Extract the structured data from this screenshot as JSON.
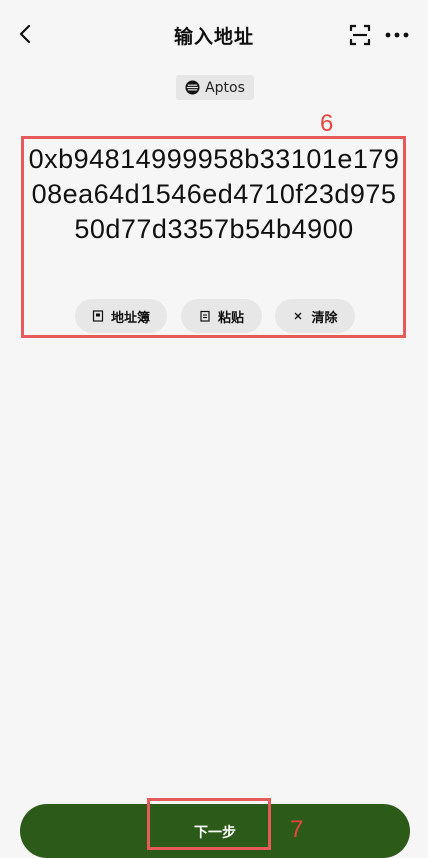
{
  "header": {
    "title": "输入地址"
  },
  "network": {
    "name": "Aptos"
  },
  "address": {
    "value": "0xb94814999958b33101e17908ea64d1546ed4710f23d97550d77d3357b54b4900"
  },
  "actions": {
    "address_book": "地址簿",
    "paste": "粘贴",
    "clear": "清除"
  },
  "footer": {
    "next_label": "下一步"
  },
  "annotations": {
    "address_step": "6",
    "next_step": "7"
  },
  "colors": {
    "accent": "#2c5a18",
    "annotation": "#e65a5a",
    "background": "#f6f6f6"
  }
}
